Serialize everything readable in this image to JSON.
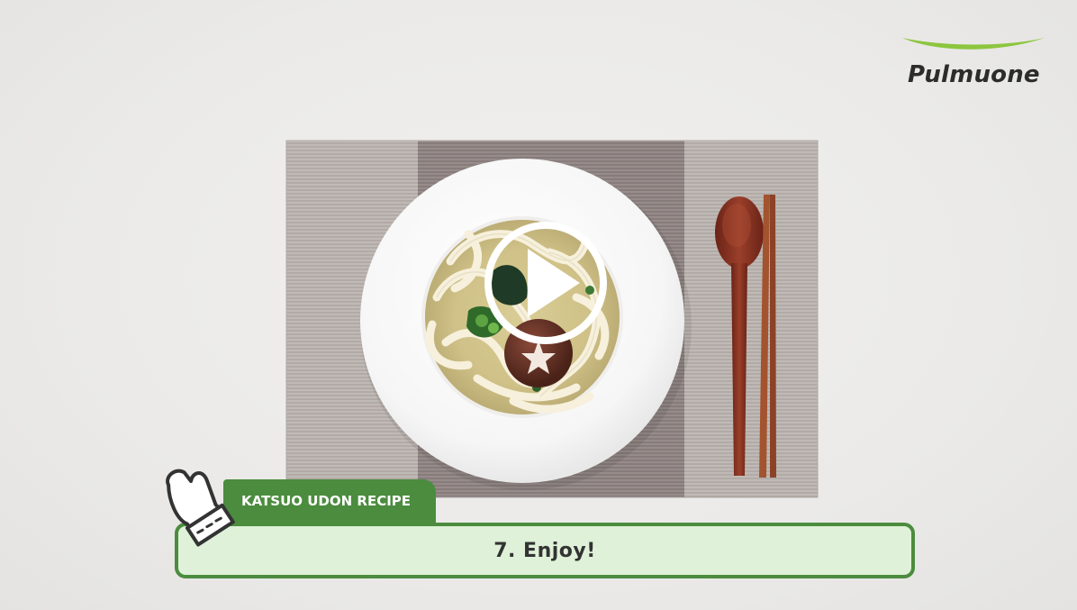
{
  "brand": {
    "name": "Pulmuone",
    "accent_color": "#8cc63f",
    "icon": "pulmuone-swoosh-logo"
  },
  "video": {
    "play_icon": "play-icon",
    "state": "paused"
  },
  "caption": {
    "recipe_title": "KATSUO UDON RECIPE",
    "step": "7. Enjoy!",
    "icon": "oven-mitt-icon",
    "theme_color": "#4b8c3e",
    "bar_color": "#dff1d8"
  }
}
